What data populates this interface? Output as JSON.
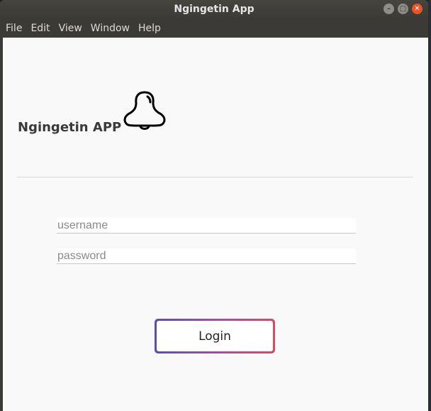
{
  "window": {
    "title": "Ngingetin App"
  },
  "menu": {
    "items": [
      "File",
      "Edit",
      "View",
      "Window",
      "Help"
    ]
  },
  "app": {
    "title": "Ngingetin APP",
    "logo_icon": "bell-icon"
  },
  "form": {
    "username_placeholder": "username",
    "username_value": "",
    "password_placeholder": "password",
    "password_value": "",
    "login_label": "Login"
  },
  "colors": {
    "titlebar": "#3b3a36",
    "close_button": "#e95420",
    "content_background": "#f9f9f9",
    "login_gradient_start": "#5b4db0",
    "login_gradient_end": "#d84c5c"
  }
}
